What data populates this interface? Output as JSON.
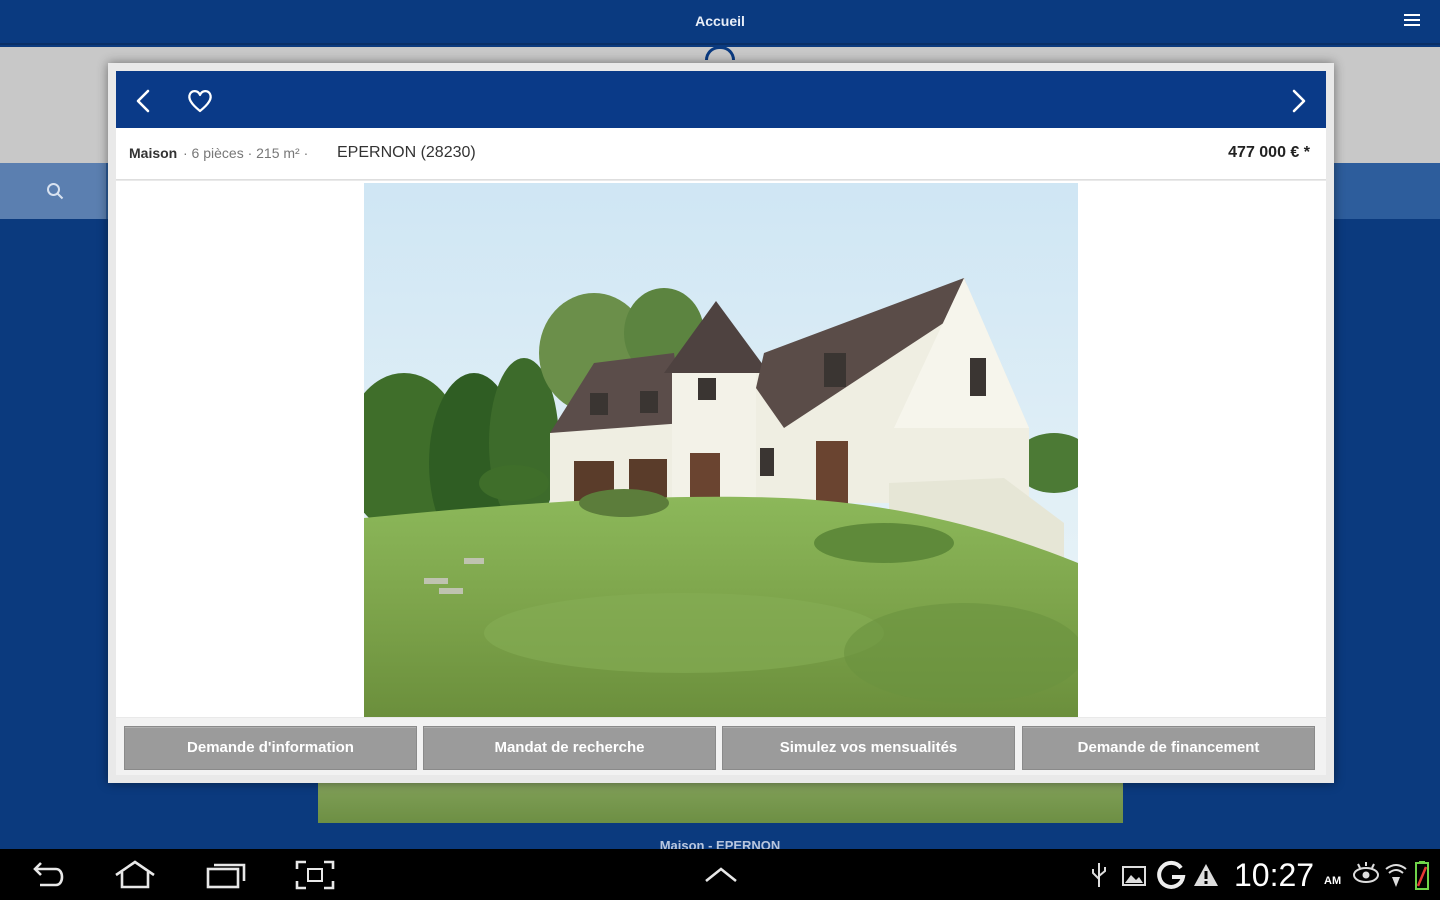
{
  "app": {
    "title": "Accueil",
    "background_caption": "Maison - EPERNON"
  },
  "icons": {
    "menu": "hamburger-menu-icon",
    "search": "search-icon",
    "prev": "chevron-left-icon",
    "favorite": "heart-icon",
    "next": "chevron-right-icon"
  },
  "colors": {
    "brand_blue": "#0a3a88",
    "button_gray": "#9b9b9b"
  },
  "listing": {
    "type": "Maison",
    "details": "· 6 pièces · 215 m² ·",
    "city": "EPERNON (28230)",
    "price": "477 000 € *"
  },
  "actions": [
    {
      "label": "Demande d'information"
    },
    {
      "label": "Mandat de recherche"
    },
    {
      "label": "Simulez vos mensualités"
    },
    {
      "label": "Demande de financement"
    }
  ],
  "system_bar": {
    "time": "10:27",
    "ampm": "AM"
  }
}
